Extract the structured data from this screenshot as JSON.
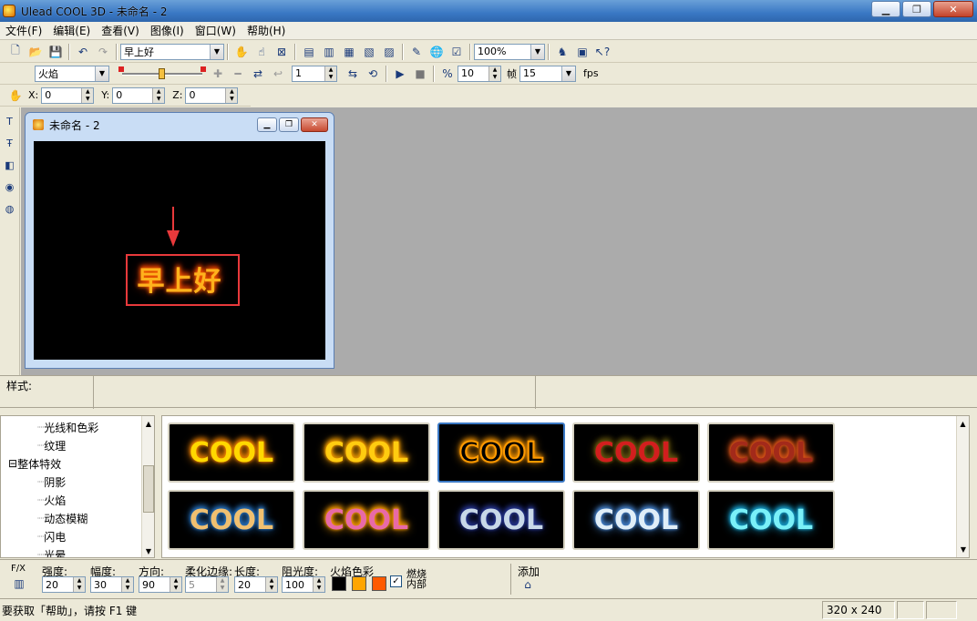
{
  "window": {
    "title": "Ulead COOL 3D - 未命名 - 2"
  },
  "menu": [
    "文件(F)",
    "编辑(E)",
    "查看(V)",
    "图像(I)",
    "窗口(W)",
    "帮助(H)"
  ],
  "toolbar1": {
    "text_object": "早上好",
    "zoom": "100%"
  },
  "toolbar2": {
    "effect": "火焰",
    "frame": "1",
    "fps_value1": "10",
    "frames_label": "帧",
    "frames_value": "15",
    "fps_label": "fps"
  },
  "toolbar3": {
    "x_label": "X:",
    "x": "0",
    "y_label": "Y:",
    "y": "0",
    "z_label": "Z:",
    "z": "0"
  },
  "document": {
    "title": "未命名 - 2",
    "canvas_text": "早上好"
  },
  "style_panel": {
    "label": "样式:"
  },
  "tree": {
    "items": [
      {
        "label": "光线和色彩",
        "indent": 2
      },
      {
        "label": "纹理",
        "indent": 2
      },
      {
        "label": "整体特效",
        "indent": 0,
        "expander": "⊟"
      },
      {
        "label": "阴影",
        "indent": 2
      },
      {
        "label": "火焰",
        "indent": 2
      },
      {
        "label": "动态模糊",
        "indent": 2
      },
      {
        "label": "闪电",
        "indent": 2
      },
      {
        "label": "光晕",
        "indent": 2
      }
    ]
  },
  "gallery": {
    "thumbs": [
      {
        "text": "COOL",
        "color": "#ffd800",
        "glow": "#ff8a00",
        "selected": false
      },
      {
        "text": "COOL",
        "color": "#ffcc10",
        "glow": "#ffa400",
        "selected": false
      },
      {
        "text": "COOL",
        "color": "#000000",
        "glow": "#ff9a00",
        "selected": true
      },
      {
        "text": "COOL",
        "color": "#d21e1e",
        "glow": "#6a5a10",
        "selected": false
      },
      {
        "text": "COOL",
        "color": "#a32a1a",
        "glow": "#e85a1a",
        "selected": false
      },
      {
        "text": "COOL",
        "color": "#f0c070",
        "glow": "#2a78c8",
        "selected": false
      },
      {
        "text": "COOL",
        "color": "#e86aa8",
        "glow": "#ffa000",
        "selected": false
      },
      {
        "text": "COOL",
        "color": "#c8d8e8",
        "glow": "#2a3a9a",
        "selected": false
      },
      {
        "text": "COOL",
        "color": "#e0eef8",
        "glow": "#4a8ad8",
        "selected": false
      },
      {
        "text": "COOL",
        "color": "#7af0f8",
        "glow": "#1aa8d8",
        "selected": false
      }
    ]
  },
  "params": {
    "fx_label": "F/X",
    "intensity_label": "强度:",
    "intensity": "20",
    "amplitude_label": "幅度:",
    "amplitude": "30",
    "direction_label": "方向:",
    "direction": "90",
    "soften_label": "柔化边缘:",
    "soften": "5",
    "length_label": "长度:",
    "length": "20",
    "opacity_label": "阻光度:",
    "opacity": "100",
    "flame_color_label": "火焰色彩",
    "flame_colors": [
      "#000000",
      "#ffa500",
      "#ff5a00"
    ],
    "burn_inside_label": "燃烧内部",
    "add_label": "添加"
  },
  "status": {
    "help_text": "要获取「帮助」，请按 F1 键",
    "size": "320 x 240"
  }
}
